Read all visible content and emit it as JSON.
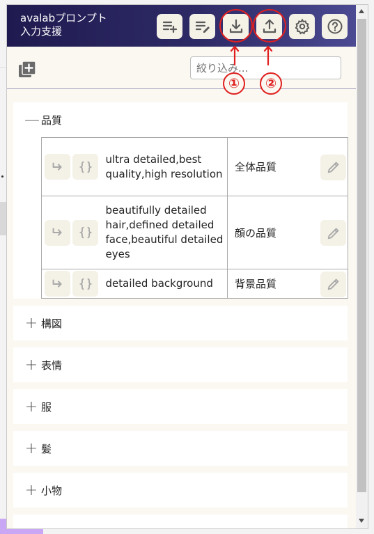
{
  "header": {
    "title": "avalabプロンプト\n入力支援",
    "buttons": [
      {
        "name": "add-list",
        "icon": "playlist-add-icon"
      },
      {
        "name": "edit-note",
        "icon": "edit-note-icon"
      },
      {
        "name": "download",
        "icon": "download-icon"
      },
      {
        "name": "upload",
        "icon": "upload-icon"
      },
      {
        "name": "settings",
        "icon": "gear-icon"
      },
      {
        "name": "help",
        "icon": "help-icon"
      }
    ]
  },
  "annotations": {
    "one": "①",
    "two": "②",
    "color": "#e02020"
  },
  "toolbar": {
    "search_placeholder": "絞り込み..."
  },
  "sections": [
    {
      "sign": "—",
      "label": "品質",
      "expanded": true,
      "rows": [
        {
          "prompt": "ultra detailed,best quality,high resolution",
          "name": "全体品質"
        },
        {
          "prompt": "beautifully detailed hair,defined detailed face,beautiful detailed eyes",
          "name": "顔の品質"
        },
        {
          "prompt": "detailed background",
          "name": "背景品質"
        }
      ]
    },
    {
      "sign": "+",
      "label": "構図",
      "expanded": false
    },
    {
      "sign": "+",
      "label": "表情",
      "expanded": false
    },
    {
      "sign": "+",
      "label": "服",
      "expanded": false
    },
    {
      "sign": "+",
      "label": "髪",
      "expanded": false
    },
    {
      "sign": "+",
      "label": "小物",
      "expanded": false
    }
  ],
  "colors": {
    "header_start": "#1f1a4f",
    "header_end": "#4b4a92",
    "button_bg": "#f4f1e6",
    "panel_bg": "#faf8f1"
  }
}
